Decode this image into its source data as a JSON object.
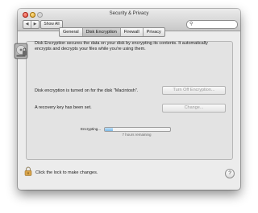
{
  "window": {
    "title": "Security & Privacy",
    "back_glyph": "◀",
    "forward_glyph": "▶",
    "show_all_label": "Show All",
    "search": {
      "value": "",
      "placeholder": "",
      "icon": "search-icon"
    }
  },
  "tabs": [
    {
      "label": "General",
      "active": false
    },
    {
      "label": "Disk Encryption",
      "active": true
    },
    {
      "label": "Firewall",
      "active": false
    },
    {
      "label": "Privacy",
      "active": false
    }
  ],
  "encryption": {
    "icon": "hard-disk-icon",
    "description": "Disk Encryption secures the data on your disk by encrypting its contents. It automatically encrypts and decrypts your files while you're using them.",
    "status_text": "Disk encryption is turned on for the disk \"Macintosh\".",
    "turn_off_button": "Turn Off Encryption...",
    "recovery_text": "A recovery key has been set.",
    "change_button": "Change...",
    "progress_label": "Encrypting...",
    "progress_fraction": 0.12,
    "remaining_text": "7 hours remaining"
  },
  "footer": {
    "lock_icon": "lock-icon",
    "lock_text": "Click the lock to make changes.",
    "help_label": "?"
  }
}
